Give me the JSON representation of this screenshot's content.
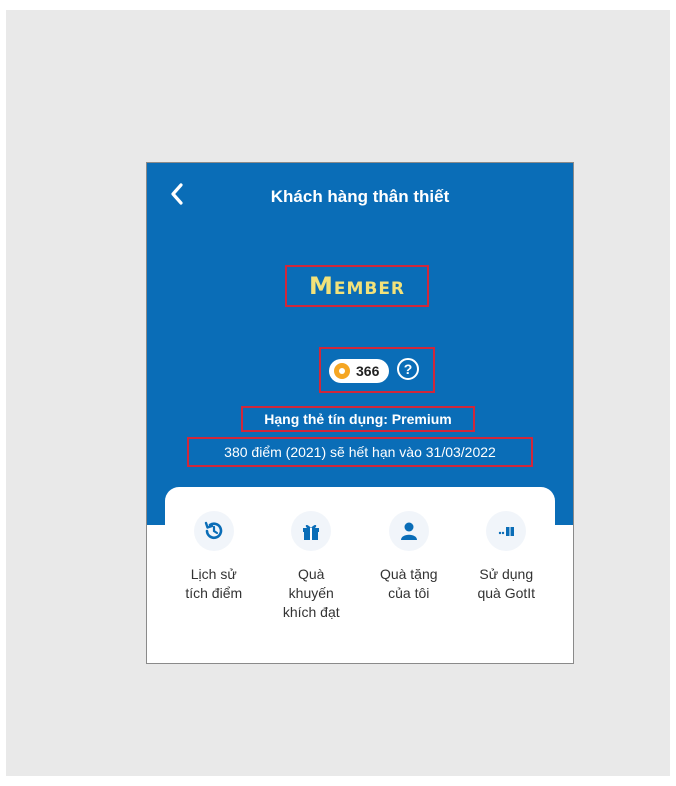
{
  "header": {
    "back_label": "<",
    "title": "Khách hàng thân thiết"
  },
  "member": {
    "tier": "Member"
  },
  "points": {
    "value": "366",
    "help_label": "?"
  },
  "rank": {
    "text": "Hạng thẻ tín dụng: Premium"
  },
  "expiry": {
    "text": "380 điểm (2021) sẽ hết hạn vào 31/03/2022"
  },
  "actions": [
    {
      "label": "Lịch sử\ntích điểm",
      "icon": "history-icon"
    },
    {
      "label": "Quà\nkhuyến\nkhích đạt",
      "icon": "gift-icon"
    },
    {
      "label": "Quà tặng\ncủa tôi",
      "icon": "user-icon"
    },
    {
      "label": "Sử dụng\nquà GotIt",
      "icon": "gotit-icon"
    }
  ],
  "colors": {
    "primary": "#0a6db7",
    "highlight_border": "#d1273a",
    "member_text": "#f2e27a",
    "coin": "#f5a623"
  }
}
